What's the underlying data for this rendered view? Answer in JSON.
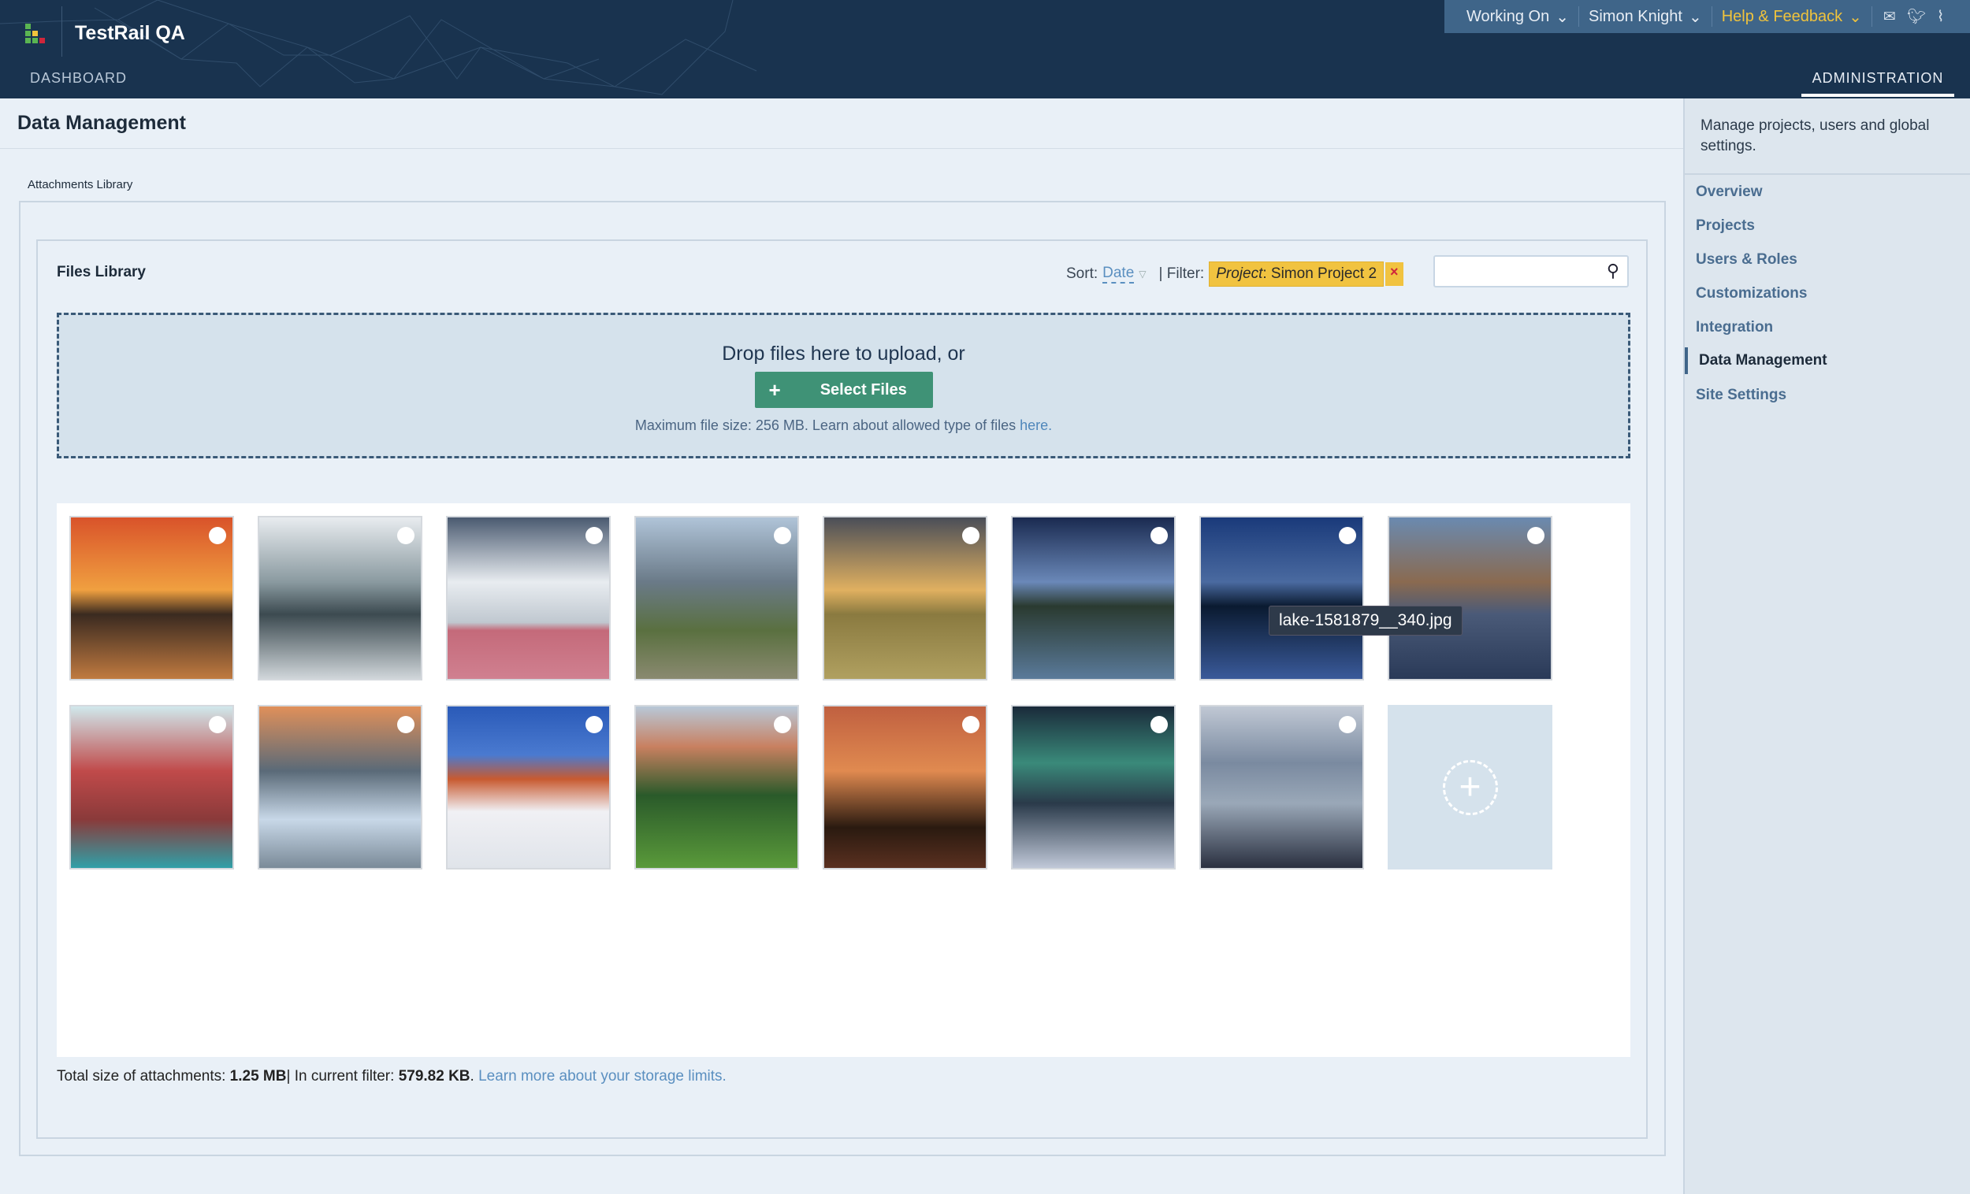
{
  "header": {
    "app_title": "TestRail QA",
    "nav_dashboard": "DASHBOARD",
    "nav_administration": "ADMINISTRATION",
    "menus": [
      {
        "label": "Working On"
      },
      {
        "label": "Simon Knight"
      },
      {
        "label": "Help & Feedback"
      }
    ],
    "icons": [
      "mail-icon",
      "twitter-icon",
      "rss-icon"
    ]
  },
  "page": {
    "title": "Data Management",
    "tab": "Attachments Library"
  },
  "library": {
    "title": "Files Library",
    "sort_label": "Sort:",
    "sort_value": "Date",
    "filter_label": "| Filter:",
    "filter_key": "Project",
    "filter_value": ": Simon Project 2",
    "filter_remove": "×",
    "search_placeholder": ""
  },
  "dropzone": {
    "text": "Drop files here to upload, or",
    "button": "Select Files",
    "button_icon": "+",
    "max_text": "Maximum file size: 256 MB. Learn about allowed type of files ",
    "max_link": "here."
  },
  "tooltip": "lake-1581879__340.jpg",
  "footer": {
    "total_label": "Total size of attachments: ",
    "total": "1.25 MB",
    "sep": "| In current filter: ",
    "filter_size": "579.82 KB",
    "dot": ". ",
    "link": "Learn more about your storage limits."
  },
  "sidebar": {
    "description": "Manage projects, users and global settings.",
    "items": [
      {
        "label": "Overview"
      },
      {
        "label": "Projects"
      },
      {
        "label": "Users & Roles"
      },
      {
        "label": "Customizations"
      },
      {
        "label": "Integration"
      },
      {
        "label": "Data Management",
        "active": true
      },
      {
        "label": "Site Settings"
      }
    ]
  },
  "colors": {
    "header": "#19334f",
    "accent_green": "#3f9276",
    "filter_chip": "#f1c340",
    "link": "#5a8fc0"
  }
}
